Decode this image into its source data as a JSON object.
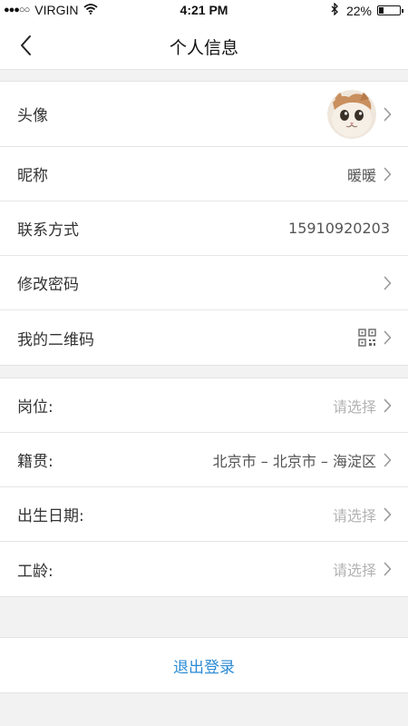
{
  "status_bar": {
    "signal": "●●●○○",
    "carrier": "VIRGIN",
    "time": "4:21 PM",
    "battery_percent": "22%",
    "battery_level": 0.22,
    "icons": [
      "wifi-icon",
      "bluetooth-icon",
      "battery-icon"
    ]
  },
  "nav": {
    "title": "个人信息",
    "back_icon": "chevron-left-icon"
  },
  "section1": {
    "avatar_label": "头像",
    "nickname_label": "昵称",
    "nickname_value": "暖暖",
    "contact_label": "联系方式",
    "contact_value": "15910920203",
    "password_label": "修改密码",
    "qrcode_label": "我的二维码",
    "qrcode_icon": "qr-code-icon"
  },
  "section2": {
    "position_label": "岗位:",
    "position_value": "请选择",
    "hometown_label": "籍贯:",
    "hometown_value": "北京市 – 北京市 – 海淀区",
    "birthday_label": "出生日期:",
    "birthday_value": "请选择",
    "seniority_label": "工龄:",
    "seniority_value": "请选择"
  },
  "logout_label": "退出登录",
  "colors": {
    "accent": "#2a8ad4",
    "placeholder": "#b3b3b3",
    "background": "#f2f2f2"
  }
}
